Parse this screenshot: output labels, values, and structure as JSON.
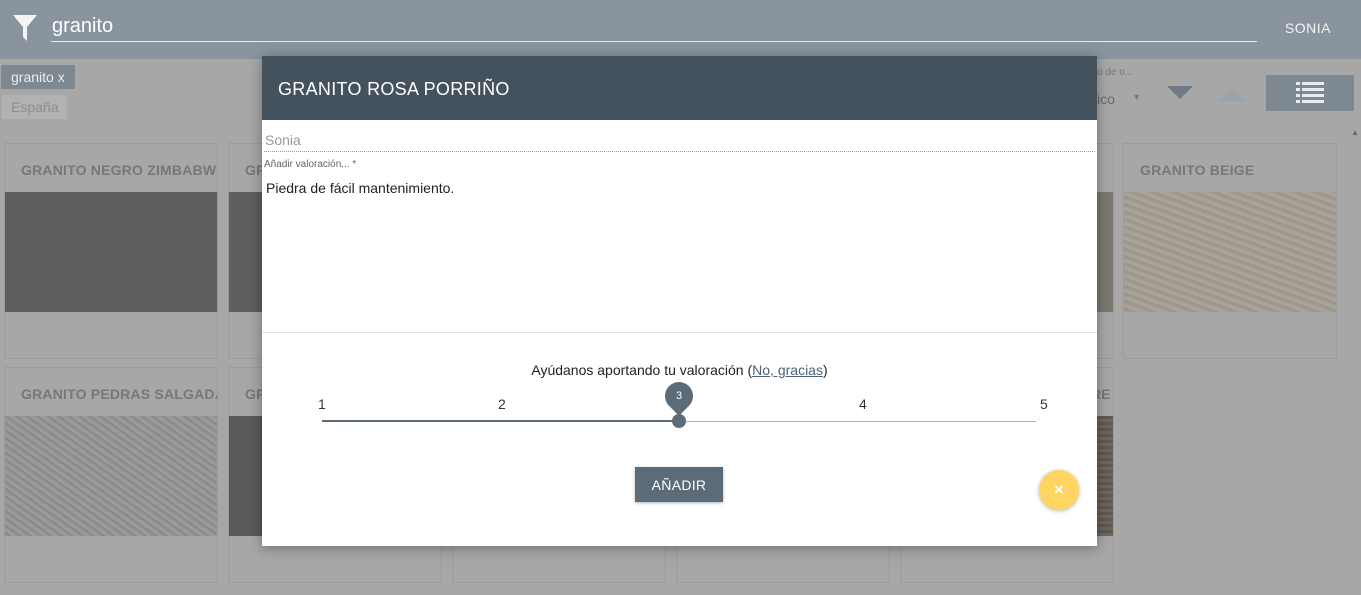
{
  "app": {
    "search_value": "granito",
    "user": "SONIA",
    "chips": [
      "granito x",
      "España"
    ],
    "order_label": "o de o...",
    "order_value": "ico",
    "order_caret": "▾"
  },
  "cards": [
    {
      "title": "GRANITO NEGRO ZIMBABWE"
    },
    {
      "title": "GR"
    },
    {
      "title": "GRANITO BEIGE"
    },
    {
      "title": "GRANITO PEDRAS SALGADAS"
    },
    {
      "title": "GR"
    },
    {
      "title": "RE"
    }
  ],
  "modal": {
    "title": "GRANITO ROSA PORRIÑO",
    "author": "Sonia",
    "review_label": "Añadir valoración... *",
    "review_text": "Piedra de fácil mantenimiento.",
    "rating_prompt": "Ayúdanos aportando tu valoración",
    "no_thanks": "No, gracias",
    "paren_open": " (",
    "paren_close": ")",
    "ticks": [
      "1",
      "2",
      "3",
      "4",
      "5"
    ],
    "rating_value": "3",
    "add_label": "AÑADIR",
    "close_label": "×"
  },
  "colors": {
    "header": "#44525e",
    "accent": "#5b6b78",
    "fab": "#ffd460"
  }
}
